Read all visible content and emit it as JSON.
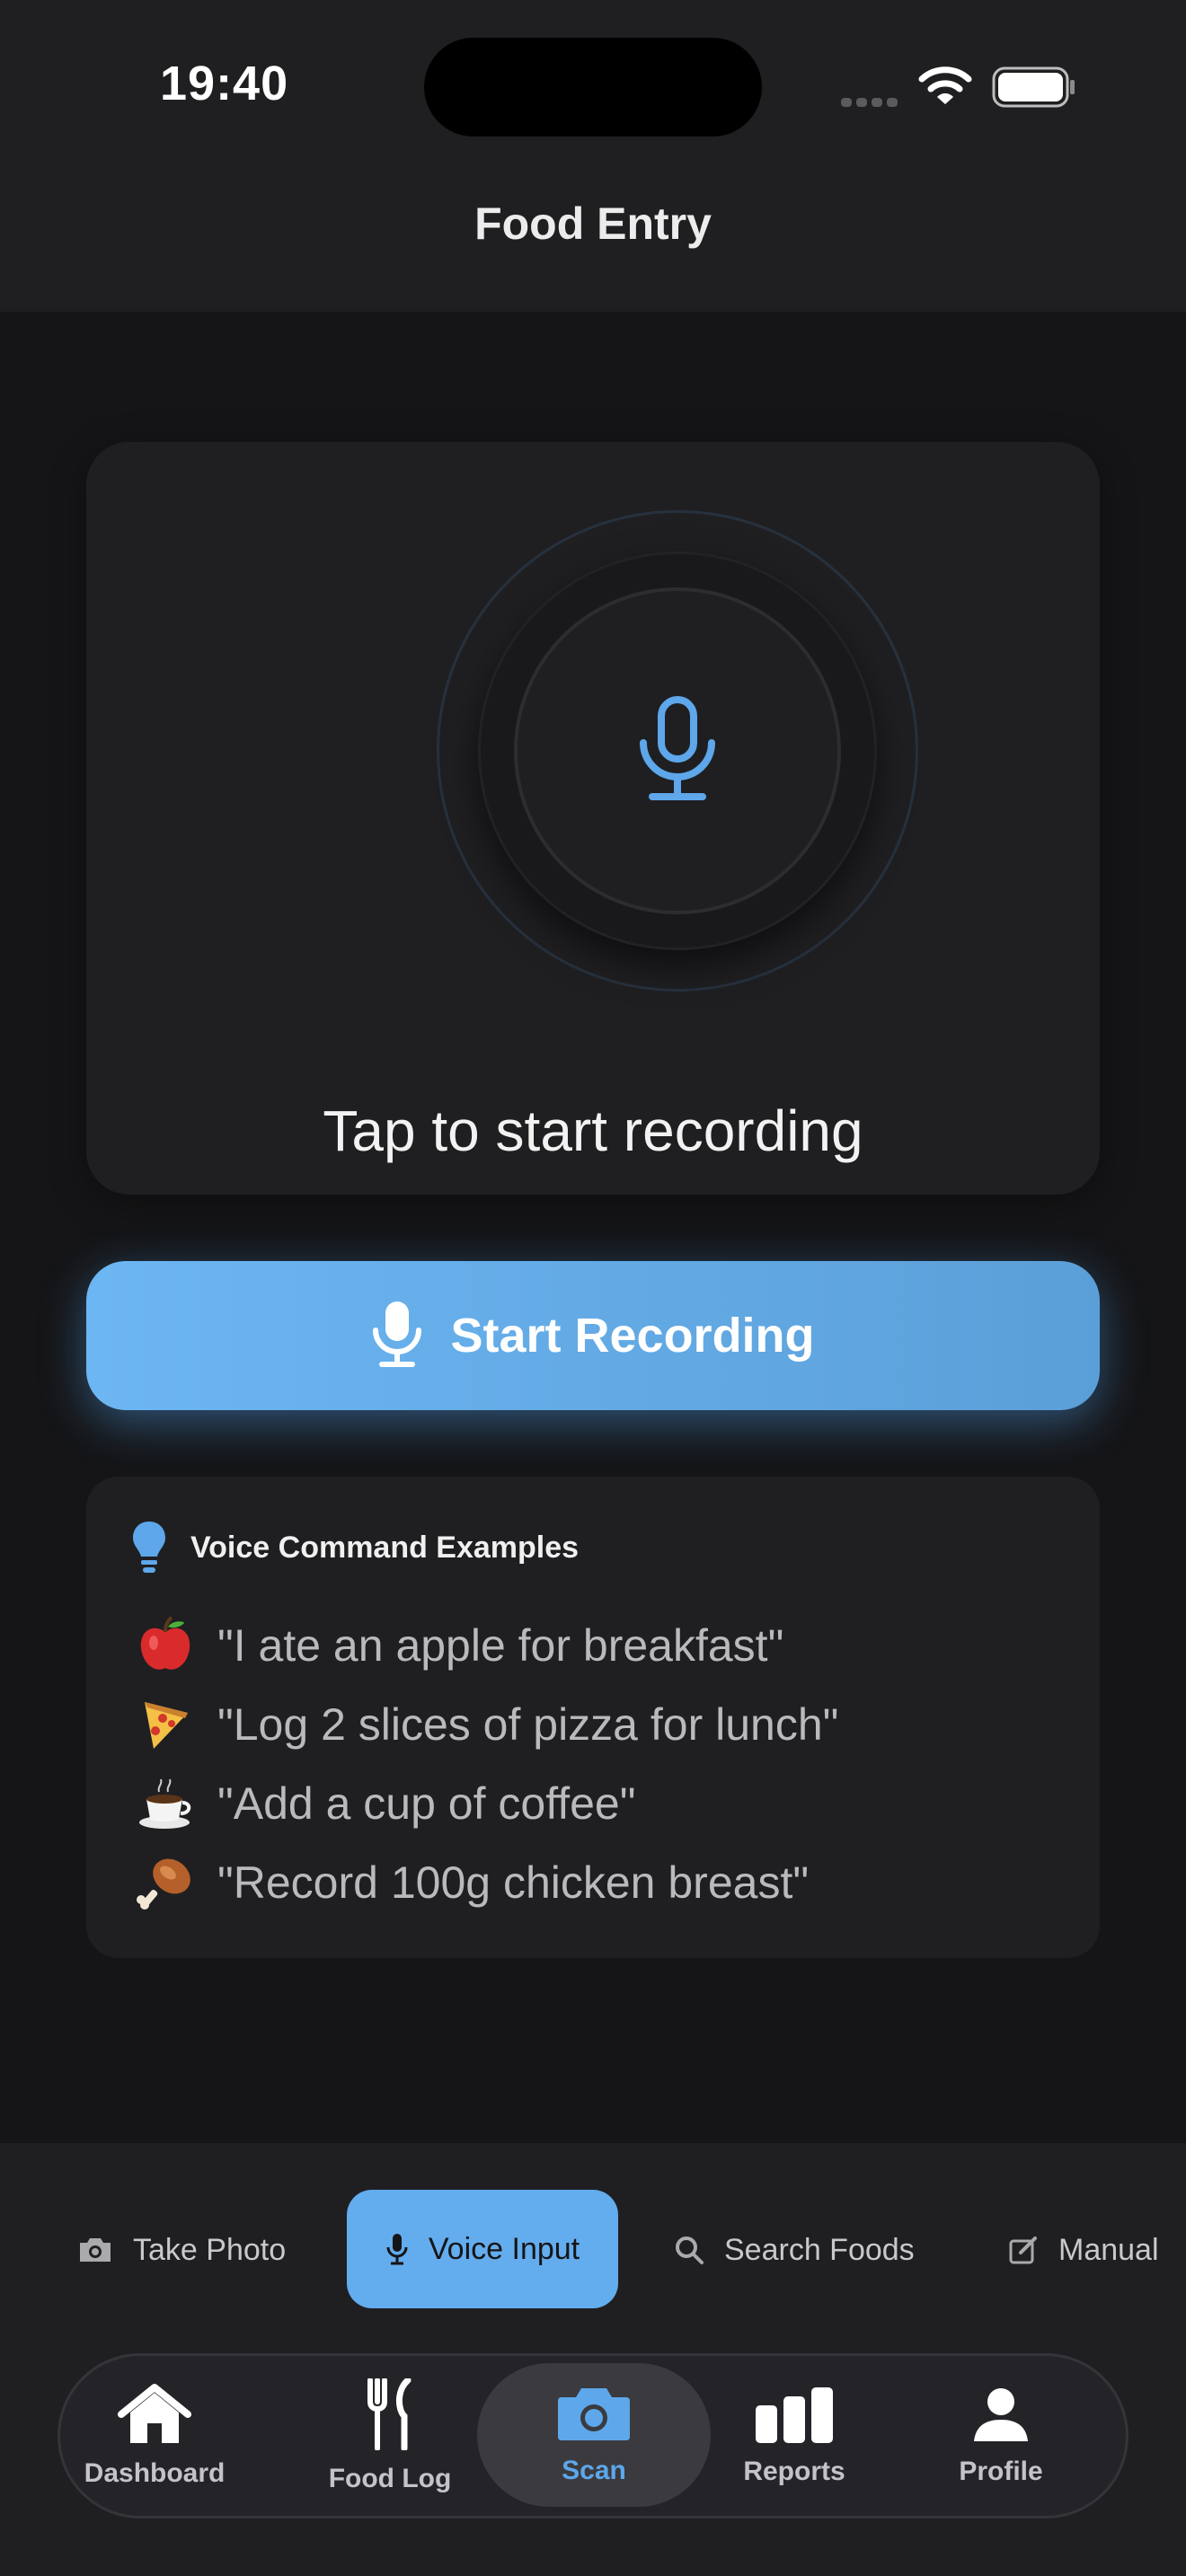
{
  "status_bar": {
    "time": "19:40"
  },
  "header": {
    "title": "Food Entry"
  },
  "recorder": {
    "status_text": "Tap to start recording",
    "mic_icon": "microphone-icon",
    "accent_color": "#5da7ea"
  },
  "start_button": {
    "label": "Start Recording"
  },
  "examples": {
    "title": "Voice Command Examples",
    "items": [
      {
        "emoji": "apple",
        "text": "\"I ate an apple for breakfast\""
      },
      {
        "emoji": "pizza",
        "text": "\"Log 2 slices of pizza for lunch\""
      },
      {
        "emoji": "coffee",
        "text": "\"Add a cup of coffee\""
      },
      {
        "emoji": "poultry-leg",
        "text": "\"Record 100g chicken breast\""
      }
    ]
  },
  "input_modes": [
    {
      "label": "Take Photo",
      "icon": "camera-icon",
      "selected": false
    },
    {
      "label": "Voice Input",
      "icon": "microphone-icon",
      "selected": true
    },
    {
      "label": "Search Foods",
      "icon": "search-icon",
      "selected": false
    },
    {
      "label": "Manual",
      "icon": "edit-icon",
      "selected": false
    }
  ],
  "tabs": [
    {
      "label": "Dashboard",
      "icon": "house-icon",
      "active": false
    },
    {
      "label": "Food Log",
      "icon": "fork-knife-icon",
      "active": false
    },
    {
      "label": "Scan",
      "icon": "camera-icon",
      "active": true
    },
    {
      "label": "Reports",
      "icon": "bar-chart-icon",
      "active": false
    },
    {
      "label": "Profile",
      "icon": "person-icon",
      "active": false
    }
  ]
}
